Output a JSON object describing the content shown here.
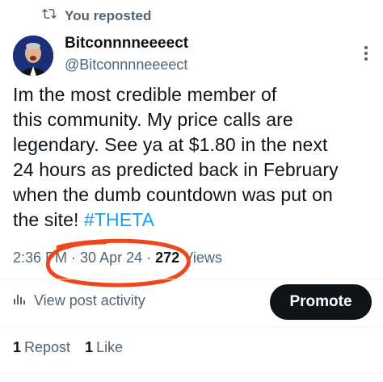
{
  "repost": {
    "icon": "repost-icon",
    "label": "You reposted"
  },
  "author": {
    "display_name": "Bitconnnneeeect",
    "handle": "@Bitconnnneeeect"
  },
  "tweet": {
    "line1": "Im the most credible member of",
    "line2": "this community. My price calls are",
    "line3": "legendary. See ya at $1.80 in the next",
    "line4": "24 hours as predicted back in February",
    "line5": "when the dumb countdown was put on",
    "line6_text": "the site! ",
    "hashtag": "#THETA"
  },
  "meta": {
    "time": "2:36 PM",
    "separator": " · ",
    "date": "30 Apr 24",
    "views_count": "272",
    "views_label": " Views"
  },
  "activity": {
    "icon": "bar-chart-icon",
    "label": "View post activity"
  },
  "promote": {
    "label": "Promote"
  },
  "stats": {
    "reposts_count": "1",
    "reposts_label": "Repost",
    "likes_count": "1",
    "likes_label": "Like"
  },
  "colors": {
    "accent": "#1d9bf0",
    "secondary_text": "#536471",
    "annotation": "#f0461e"
  }
}
